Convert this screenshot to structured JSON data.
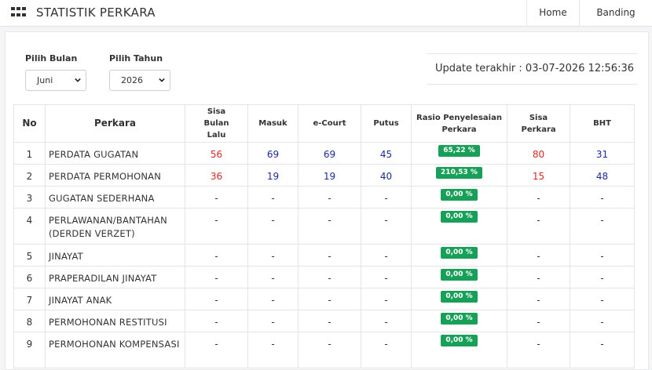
{
  "header": {
    "title": "STATISTIK PERKARA",
    "nav": [
      "Home",
      "Banding"
    ]
  },
  "filters": {
    "month_label": "Pilih Bulan",
    "month_value": "Juni",
    "year_label": "Pilih Tahun",
    "year_value": "2026"
  },
  "update_text": "Update terakhir : 03-07-2026 12:56:36",
  "table": {
    "columns": [
      "No",
      "Perkara",
      "Sisa Bulan Lalu",
      "Masuk",
      "e-Court",
      "Putus",
      "Rasio Penyelesaian Perkara",
      "Sisa Perkara",
      "BHT"
    ],
    "rows": [
      {
        "no": "1",
        "perkara": "PERDATA GUGATAN",
        "sisa_bulan_lalu": "56",
        "masuk": "69",
        "ecourt": "69",
        "putus": "45",
        "rasio": "65,22 %",
        "sisa_perkara": "80",
        "bht": "31"
      },
      {
        "no": "2",
        "perkara": "PERDATA PERMOHONAN",
        "sisa_bulan_lalu": "36",
        "masuk": "19",
        "ecourt": "19",
        "putus": "40",
        "rasio": "210,53 %",
        "sisa_perkara": "15",
        "bht": "48"
      },
      {
        "no": "3",
        "perkara": "GUGATAN SEDERHANA",
        "sisa_bulan_lalu": "-",
        "masuk": "-",
        "ecourt": "-",
        "putus": "-",
        "rasio": "0,00 %",
        "sisa_perkara": "-",
        "bht": "-"
      },
      {
        "no": "4",
        "perkara": "PERLAWANAN/BANTAHAN (DERDEN VERZET)",
        "sisa_bulan_lalu": "-",
        "masuk": "-",
        "ecourt": "-",
        "putus": "-",
        "rasio": "0,00 %",
        "sisa_perkara": "-",
        "bht": "-"
      },
      {
        "no": "5",
        "perkara": "JINAYAT",
        "sisa_bulan_lalu": "-",
        "masuk": "-",
        "ecourt": "-",
        "putus": "-",
        "rasio": "0,00 %",
        "sisa_perkara": "-",
        "bht": "-"
      },
      {
        "no": "6",
        "perkara": "PRAPERADILAN JINAYAT",
        "sisa_bulan_lalu": "-",
        "masuk": "-",
        "ecourt": "-",
        "putus": "-",
        "rasio": "0,00 %",
        "sisa_perkara": "-",
        "bht": "-"
      },
      {
        "no": "7",
        "perkara": "JINAYAT ANAK",
        "sisa_bulan_lalu": "-",
        "masuk": "-",
        "ecourt": "-",
        "putus": "-",
        "rasio": "0,00 %",
        "sisa_perkara": "-",
        "bht": "-"
      },
      {
        "no": "8",
        "perkara": "PERMOHONAN RESTITUSI",
        "sisa_bulan_lalu": "-",
        "masuk": "-",
        "ecourt": "-",
        "putus": "-",
        "rasio": "0,00 %",
        "sisa_perkara": "-",
        "bht": "-"
      },
      {
        "no": "9",
        "perkara": "PERMOHONAN KOMPENSASI",
        "sisa_bulan_lalu": "-",
        "masuk": "-",
        "ecourt": "-",
        "putus": "-",
        "rasio": "0,00 %",
        "sisa_perkara": "-",
        "bht": "-"
      }
    ]
  },
  "icons": {
    "menu": "grid-menu-icon",
    "dropdown": "chevron-down-icon"
  },
  "colors": {
    "accent_green": "#18a058",
    "value_red": "#d9281f",
    "value_blue": "#1a2a9b"
  }
}
